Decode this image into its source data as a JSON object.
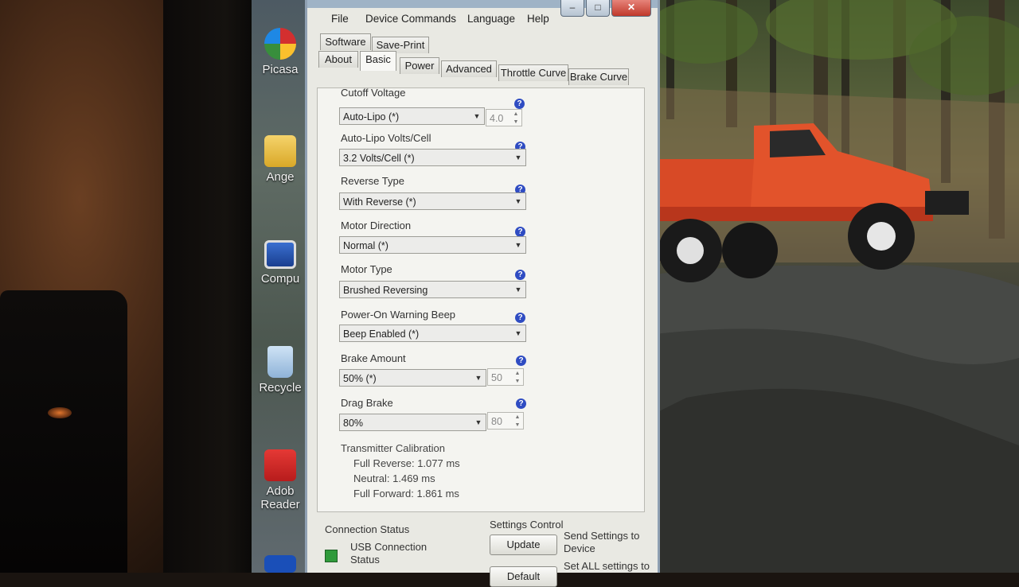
{
  "desktop": {
    "icons": [
      {
        "label": "Picasa",
        "icon": "picasa-icon"
      },
      {
        "label": "Ange",
        "icon": "folder-icon"
      },
      {
        "label": "Compu",
        "icon": "computer-icon"
      },
      {
        "label": "Recycle",
        "icon": "recycle-bin-icon"
      },
      {
        "label": "Adob",
        "icon": "adobe-reader-icon"
      },
      {
        "label": "Reader",
        "icon": "adobe-reader-icon"
      }
    ]
  },
  "window": {
    "controls": {
      "minimize": "–",
      "maximize": "□",
      "close": "✕"
    },
    "menu": [
      "File",
      "Device Commands",
      "Language",
      "Help"
    ],
    "tabs_row1": [
      "Software",
      "Save-Print"
    ],
    "tabs_row2": [
      "About",
      "Basic",
      "Power",
      "Advanced",
      "Throttle Curve",
      "Brake Curve"
    ],
    "active_tab": "Basic"
  },
  "fields": {
    "cutoff_voltage": {
      "label": "Cutoff Voltage",
      "value": "Auto-Lipo (*)",
      "number": "4.0"
    },
    "auto_lipo": {
      "label": "Auto-Lipo Volts/Cell",
      "value": "3.2 Volts/Cell (*)"
    },
    "reverse_type": {
      "label": "Reverse Type",
      "value": "With Reverse (*)"
    },
    "motor_direction": {
      "label": "Motor Direction",
      "value": "Normal (*)"
    },
    "motor_type": {
      "label": "Motor Type",
      "value": "Brushed Reversing"
    },
    "warning_beep": {
      "label": "Power-On Warning Beep",
      "value": "Beep Enabled (*)"
    },
    "brake_amount": {
      "label": "Brake Amount",
      "value": "50% (*)",
      "number": "50"
    },
    "drag_brake": {
      "label": "Drag Brake",
      "value": "80%",
      "number": "80"
    }
  },
  "help_glyph": "?",
  "calibration": {
    "title": "Transmitter Calibration",
    "full_reverse": "Full Reverse: 1.077 ms",
    "neutral": "Neutral: 1.469 ms",
    "full_forward": "Full Forward: 1.861 ms"
  },
  "connection": {
    "title": "Connection Status",
    "status_line1": "USB Connection",
    "status_line2": "Status",
    "status_color": "#2f9a3b"
  },
  "settings_control": {
    "title": "Settings Control",
    "update_label": "Update",
    "send_line1": "Send Settings to",
    "send_line2": "Device",
    "default_label": "Default",
    "all_line1": "Set ALL settings to"
  }
}
